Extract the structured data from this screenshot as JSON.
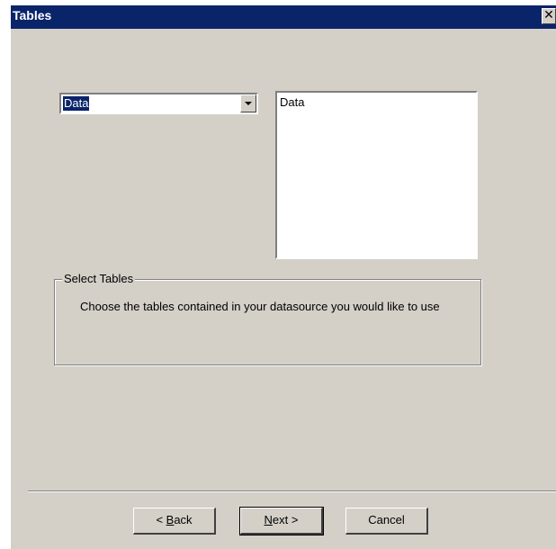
{
  "window": {
    "title": "Tables",
    "close_glyph": "✕",
    "title_bar_color": "#0a246a",
    "face_color": "#d4d0c8"
  },
  "combo": {
    "selected_value": "Data"
  },
  "listbox": {
    "items": [
      "Data"
    ]
  },
  "group": {
    "title": "Select Tables",
    "description": "Choose the tables contained in your datasource you would like to use"
  },
  "buttons": {
    "back": {
      "prefix": "< ",
      "accel": "B",
      "rest": "ack"
    },
    "next": {
      "accel": "N",
      "rest": "ext >"
    },
    "cancel": "Cancel"
  }
}
